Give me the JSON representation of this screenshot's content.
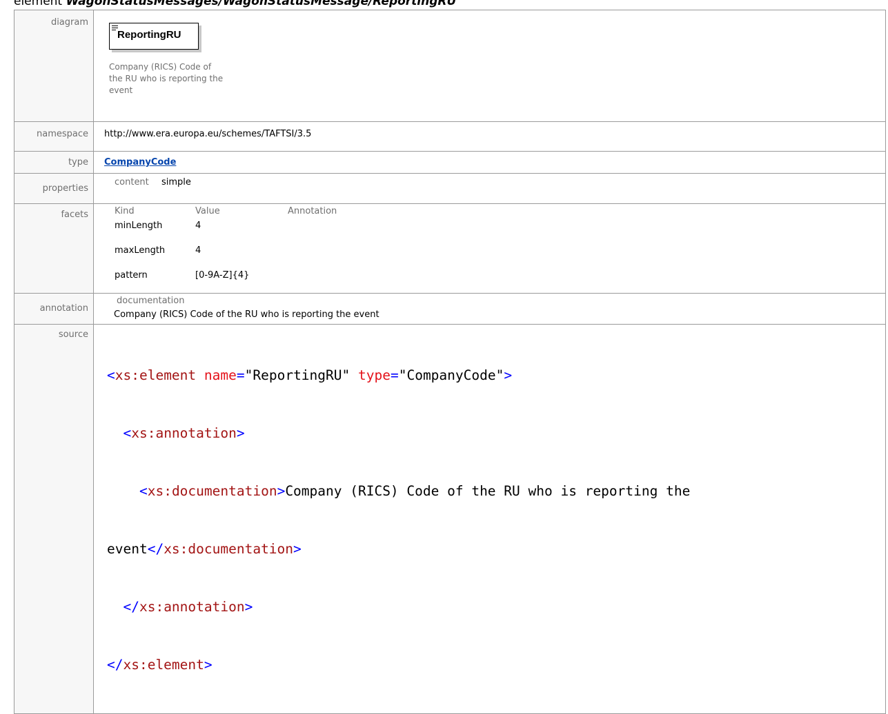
{
  "header": {
    "keyword": "element",
    "path": "WagonStatusMessages/WagonStatusMessage/ReportingRU"
  },
  "rows": {
    "diagram": {
      "label": "diagram",
      "element_name": "ReportingRU",
      "documentation_lines": [
        "Company (RICS) Code of",
        "the RU who is reporting the",
        "event"
      ]
    },
    "namespace": {
      "label": "namespace",
      "value": "http://www.era.europa.eu/schemes/TAFTSI/3.5"
    },
    "type": {
      "label": "type",
      "value": "CompanyCode"
    },
    "properties": {
      "label": "properties",
      "key": "content",
      "value": "simple"
    },
    "facets": {
      "label": "facets",
      "columns": [
        "Kind",
        "Value",
        "Annotation"
      ],
      "items": [
        {
          "kind": "minLength",
          "value": "4",
          "annotation": ""
        },
        {
          "kind": "maxLength",
          "value": "4",
          "annotation": ""
        },
        {
          "kind": "pattern",
          "value": "[0-9A-Z]{4}",
          "annotation": ""
        }
      ]
    },
    "annotation": {
      "label": "annotation",
      "key": "documentation",
      "value": "Company (RICS) Code of the RU who is reporting the event"
    },
    "source": {
      "label": "source",
      "lines": [
        "<xs:element name=\"ReportingRU\" type=\"CompanyCode\">",
        "  <xs:annotation>",
        "    <xs:documentation>Company (RICS) Code of the RU who is reporting the",
        "event</xs:documentation>",
        "  </xs:annotation>",
        "</xs:element>"
      ]
    }
  }
}
